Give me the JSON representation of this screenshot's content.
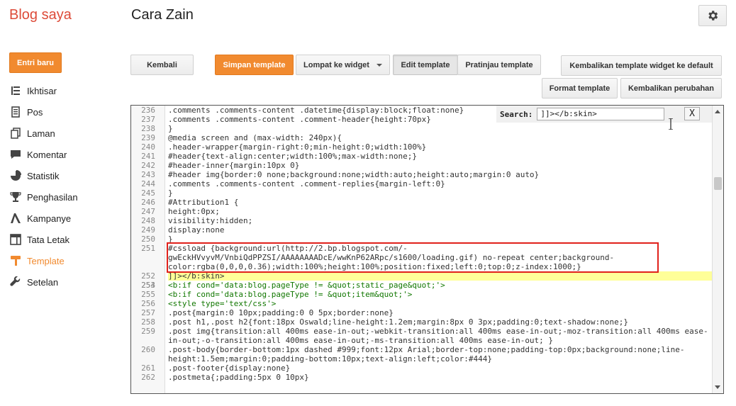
{
  "header": {
    "brand": "Blog saya",
    "blog_title": "Cara Zain",
    "settings_icon": "gear-icon"
  },
  "sidebar": {
    "new_post": "Entri baru",
    "items": [
      {
        "label": "Ikhtisar",
        "icon": "list-icon"
      },
      {
        "label": "Pos",
        "icon": "document-icon"
      },
      {
        "label": "Laman",
        "icon": "pages-icon"
      },
      {
        "label": "Komentar",
        "icon": "comment-icon"
      },
      {
        "label": "Statistik",
        "icon": "pie-chart-icon"
      },
      {
        "label": "Penghasilan",
        "icon": "trophy-icon"
      },
      {
        "label": "Kampanye",
        "icon": "campaign-icon"
      },
      {
        "label": "Tata Letak",
        "icon": "layout-icon"
      },
      {
        "label": "Template",
        "icon": "template-icon",
        "active": true
      },
      {
        "label": "Setelan",
        "icon": "wrench-icon"
      }
    ]
  },
  "toolbar": {
    "back": "Kembali",
    "save": "Simpan template",
    "jump": "Lompat ke widget",
    "edit": "Edit template",
    "preview": "Pratinjau template",
    "reset_widgets": "Kembalikan template widget ke default",
    "format": "Format template",
    "revert": "Kembalikan perubahan"
  },
  "search": {
    "label": "Search:",
    "value": "]]></b:skin>",
    "close": "X"
  },
  "colors": {
    "accent": "#f18a2f",
    "brand": "#dd4b39",
    "highlight_box": "#e0211b"
  },
  "code_lines": [
    {
      "n": "236",
      "text": ".comments .comments-content .datetime{display:block;float:none}"
    },
    {
      "n": "237",
      "text": ".comments .comments-content .comment-header{height:70px}"
    },
    {
      "n": "238",
      "text": "}"
    },
    {
      "n": "239",
      "text": "@media screen and (max-width: 240px){"
    },
    {
      "n": "240",
      "text": ".header-wrapper{margin-right:0;min-height:0;width:100%}"
    },
    {
      "n": "241",
      "text": "#header{text-align:center;width:100%;max-width:none;}"
    },
    {
      "n": "242",
      "text": "#header-inner{margin:10px 0}"
    },
    {
      "n": "243",
      "text": "#header img{border:0 none;background:none;width:auto;height:auto;margin:0 auto}"
    },
    {
      "n": "244",
      "text": ".comments .comments-content .comment-replies{margin-left:0}"
    },
    {
      "n": "245",
      "text": "}"
    },
    {
      "n": "246",
      "text": "#Attribution1 {"
    },
    {
      "n": "247",
      "text": "height:0px;"
    },
    {
      "n": "248",
      "text": "visibility:hidden;"
    },
    {
      "n": "249",
      "text": "display:none"
    },
    {
      "n": "250",
      "text": "}"
    },
    {
      "n": "251",
      "text": "#cssload {background:url(http://2.bp.blogspot.com/-gwEckHVvyvM/VnbiQdPPZSI/AAAAAAAADcE/wwKnP62ARpc/s1600/loading.gif) no-repeat center;background-color:rgba(0,0,0,0.36);width:100%;height:100%;position:fixed;left:0;top:0;z-index:1000;}"
    },
    {
      "n": "252",
      "text": "]]></b:skin>"
    },
    {
      "n": "253",
      "text": ""
    },
    {
      "n": "254",
      "text": "<b:if cond='data:blog.pageType != &quot;static_page&quot;'>"
    },
    {
      "n": "255",
      "text": "<b:if cond='data:blog.pageType != &quot;item&quot;'>"
    },
    {
      "n": "256",
      "text": "<style type='text/css'>"
    },
    {
      "n": "257",
      "text": ".post{margin:0 10px;padding:0 0 5px;border:none}"
    },
    {
      "n": "258",
      "text": ".post h1,.post h2{font:18px Oswald;line-height:1.2em;margin:8px 0 3px;padding:0;text-shadow:none;}"
    },
    {
      "n": "259",
      "text": ".post img{transition:all 400ms ease-in-out;-webkit-transition:all 400ms ease-in-out;-moz-transition:all 400ms ease-in-out;-o-transition:all 400ms ease-in-out;-ms-transition:all 400ms ease-in-out; }"
    },
    {
      "n": "260",
      "text": ".post-body{border-bottom:1px dashed #999;font:12px Arial;border-top:none;padding-top:0px;background:none;line-height:1.5em;margin:0;padding-bottom:10px;text-align:left;color:#444}"
    },
    {
      "n": "261",
      "text": ".post-footer{display:none}"
    },
    {
      "n": "262",
      "text": ".postmeta{;padding:5px 0 10px}"
    }
  ]
}
